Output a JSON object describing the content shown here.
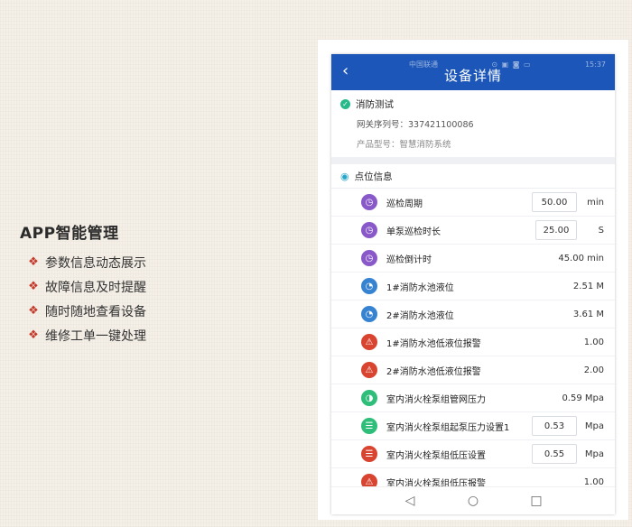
{
  "features": {
    "title": "APP智能管理",
    "bullet": "❖",
    "items": [
      "参数信息动态展示",
      "故障信息及时提醒",
      "随时随地查看设备",
      "维修工单一键处理"
    ]
  },
  "phone": {
    "status": {
      "carrier": "中国联通 ",
      "icons": "⊙ ▣ ◙ ▭",
      "time": "15:37"
    },
    "header": {
      "back_icon": "‹",
      "title": "设备详情"
    },
    "device": {
      "name": "消防测试",
      "serial": "网关序列号：337421100086",
      "model": "产品型号：智慧消防系统"
    },
    "points_title": "点位信息",
    "rows": [
      {
        "label": "巡检周期",
        "value": "50.00",
        "unit": "min"
      },
      {
        "label": "单泵巡检时长",
        "value": "25.00",
        "unit": "S"
      },
      {
        "label": "巡检倒计时",
        "value": "45.00 min"
      },
      {
        "label": "1#消防水池液位",
        "value": "2.51 M"
      },
      {
        "label": "2#消防水池液位",
        "value": "3.61 M"
      },
      {
        "label": "1#消防水池低液位报警",
        "value": "1.00"
      },
      {
        "label": "2#消防水池低液位报警",
        "value": "2.00"
      },
      {
        "label": "室内消火栓泵组管网压力",
        "value": "0.59 Mpa"
      },
      {
        "label": "室内消火栓泵组起泵压力设置1",
        "value": "0.53",
        "unit": "Mpa"
      },
      {
        "label": "室内消火栓泵组低压设置",
        "value": "0.55",
        "unit": "Mpa"
      },
      {
        "label": "室内消火栓泵组低压报警",
        "value": "1.00"
      }
    ],
    "nav": {
      "back": "◁",
      "home": "○",
      "recent": "□"
    }
  },
  "colors": {
    "header": "#1b56b8",
    "purple_icon": "#8a59c9",
    "blue_icon": "#3683d2",
    "red_icon": "#d8442f",
    "green_icon": "#2fbe7a",
    "bullet": "#c43a2a"
  }
}
